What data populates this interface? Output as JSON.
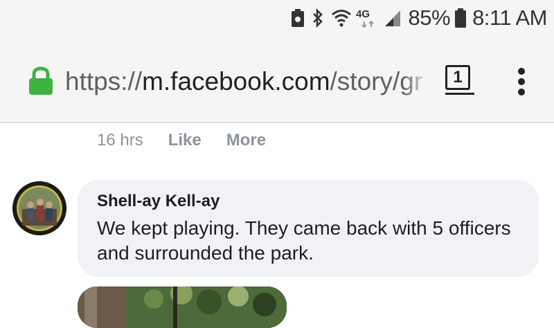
{
  "status_bar": {
    "network_label": "4G",
    "battery": "85%",
    "time": "8:11 AM",
    "icons": [
      "android-icon",
      "bluetooth-icon",
      "wifi-icon",
      "lte-icon",
      "signal-icon",
      "battery-icon"
    ]
  },
  "browser": {
    "url_scheme": "https://",
    "url_host": "m.facebook.com",
    "url_path": "/story/gr",
    "tab_count": "1",
    "colors": {
      "lock": "#3fb23f",
      "bar": "#f5f5f5"
    }
  },
  "post_meta": {
    "time": "16 hrs",
    "like": "Like",
    "more": "More"
  },
  "comment": {
    "author": "Shell-ay Kell-ay",
    "text": "We kept playing. They came back with 5 officers and surrounded the park."
  }
}
